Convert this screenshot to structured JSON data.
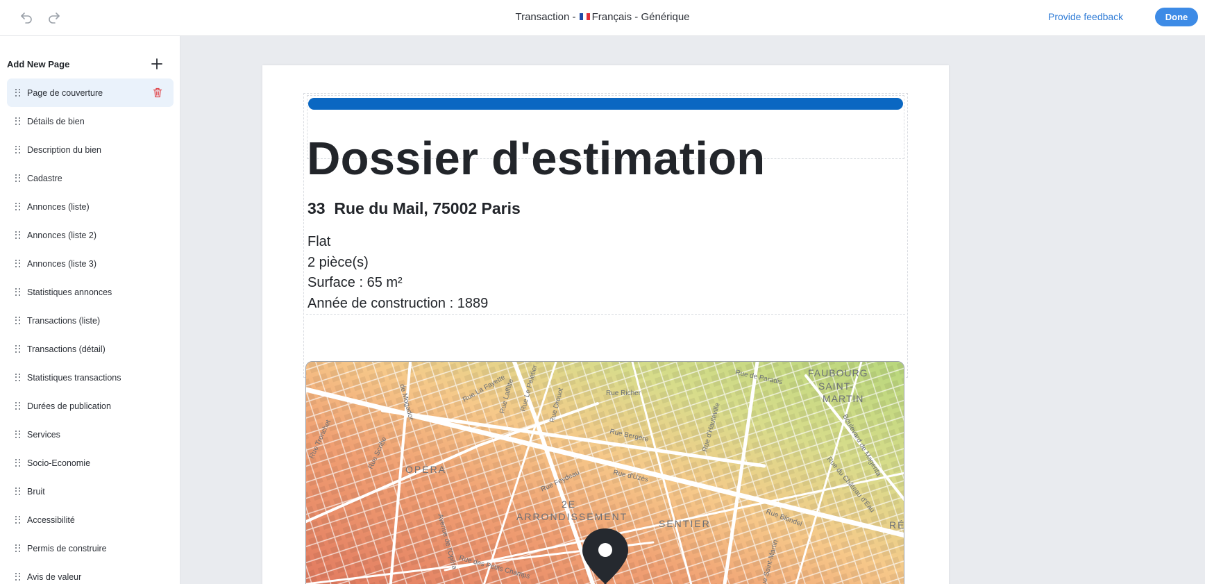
{
  "topbar": {
    "title_prefix": "Transaction - ",
    "title_suffix": "Français - Générique",
    "flag": "fr-flag-icon",
    "feedback_label": "Provide feedback",
    "done_label": "Done"
  },
  "sidebar": {
    "heading": "Add New Page",
    "items": [
      {
        "label": "Page de couverture",
        "active": true
      },
      {
        "label": "Détails de bien"
      },
      {
        "label": "Description du bien"
      },
      {
        "label": "Cadastre"
      },
      {
        "label": "Annonces (liste)"
      },
      {
        "label": "Annonces (liste 2)"
      },
      {
        "label": "Annonces (liste 3)"
      },
      {
        "label": "Statistiques annonces"
      },
      {
        "label": "Transactions (liste)"
      },
      {
        "label": "Transactions (détail)"
      },
      {
        "label": "Statistiques transactions"
      },
      {
        "label": "Durées de publication"
      },
      {
        "label": "Services"
      },
      {
        "label": "Socio-Economie"
      },
      {
        "label": "Bruit"
      },
      {
        "label": "Accessibilité"
      },
      {
        "label": "Permis de construire"
      },
      {
        "label": "Avis de valeur"
      }
    ]
  },
  "document": {
    "title": "Dossier d'estimation",
    "address": "33  Rue du Mail, 75002 Paris",
    "property_type": "Flat",
    "rooms": "2 pièce(s)",
    "surface": "Surface : 65 m²",
    "year": "Année de construction : 1889"
  },
  "map": {
    "labels": [
      "de Mogador",
      "Rue La Fayette",
      "Rue Laffitte",
      "Rue Le Peletier",
      "Rue Drouot",
      "Rue Richer",
      "Rue de Paradis",
      "FAUBOURG",
      "SAINT-",
      "MARTIN",
      "Rue Tronchet",
      "Rue Scribe",
      "OPÉRA",
      "Rue Bergère",
      "Rue d'Hauteville",
      "Boulevard de Magenta",
      "Rue du Château d'Eau",
      "Rue d'Uzès",
      "Rue Feydeau",
      "2E",
      "ARRONDISSEMENT",
      "SENTIER",
      "Rue Blondel",
      "Rue Saint-Martin",
      "RÉ",
      "Avenue de l'Opéra",
      "Rue des Petits Champs"
    ],
    "accent": "#0a67c2"
  }
}
